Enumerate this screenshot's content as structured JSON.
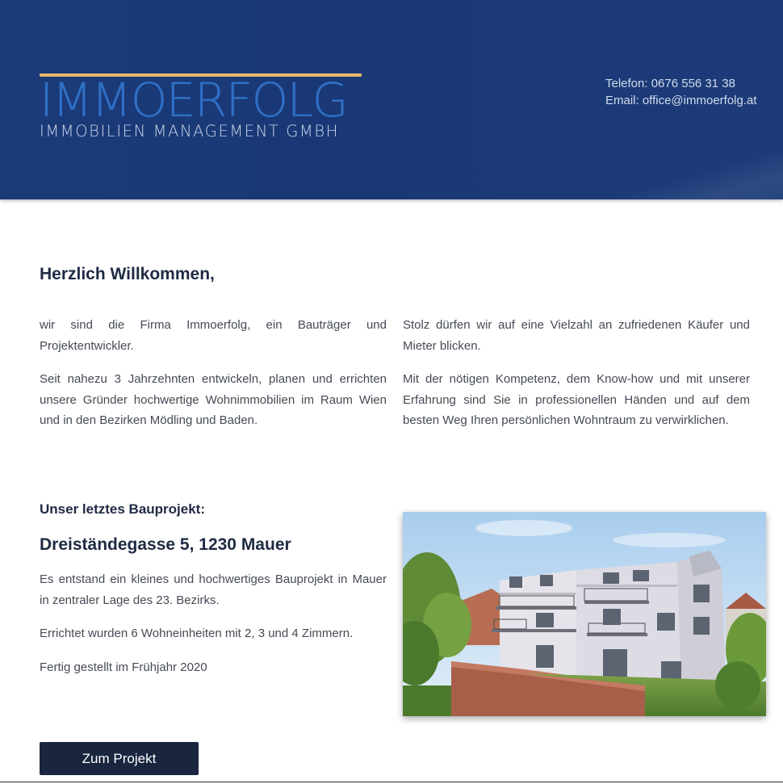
{
  "header": {
    "logo_name": "IMMOERFOLG",
    "logo_subtitle": "IMMOBILIEN MANAGEMENT GMBH",
    "phone": "Telefon: 0676 556 31 38",
    "email": "Email: office@immoerfolg.at"
  },
  "welcome": {
    "heading": "Herzlich Willkommen,",
    "left_paragraphs": [
      "wir sind die Firma Immoerfolg, ein Bauträger und Projektentwickler.",
      "Seit nahezu 3 Jahrzehnten entwickeln, planen und errichten unsere Gründer hochwertige Wohnimmobilien im Raum Wien und in den Bezirken Mödling und Baden."
    ],
    "right_paragraphs": [
      "Stolz dürfen wir auf eine Vielzahl an zufriedenen Käufer und Mieter blicken.",
      "Mit der nötigen Kompetenz, dem Know-how und mit unserer Erfahrung sind Sie in professionellen Händen und auf dem besten Weg Ihren persönlichen Wohntraum zu verwirklichen."
    ]
  },
  "project": {
    "kicker": "Unser letztes Bauprojekt:",
    "title": "Dreiständegasse 5, 1230 Mauer",
    "paragraphs": [
      "Es entstand ein kleines und hochwertiges Bauprojekt in Mauer in zentraler Lage des 23. Bezirks.",
      "Errichtet wurden 6 Wohneinheiten mit 2, 3 und 4 Zimmern.",
      "Fertig gestellt im Frühjahr 2020"
    ],
    "button_label": "Zum Projekt"
  },
  "colors": {
    "header_blue": "#1b3a78",
    "logo_blue": "#2f6fc4",
    "logo_accent": "#e9b86b",
    "heading": "#1f2a44",
    "button": "#1a2640"
  }
}
